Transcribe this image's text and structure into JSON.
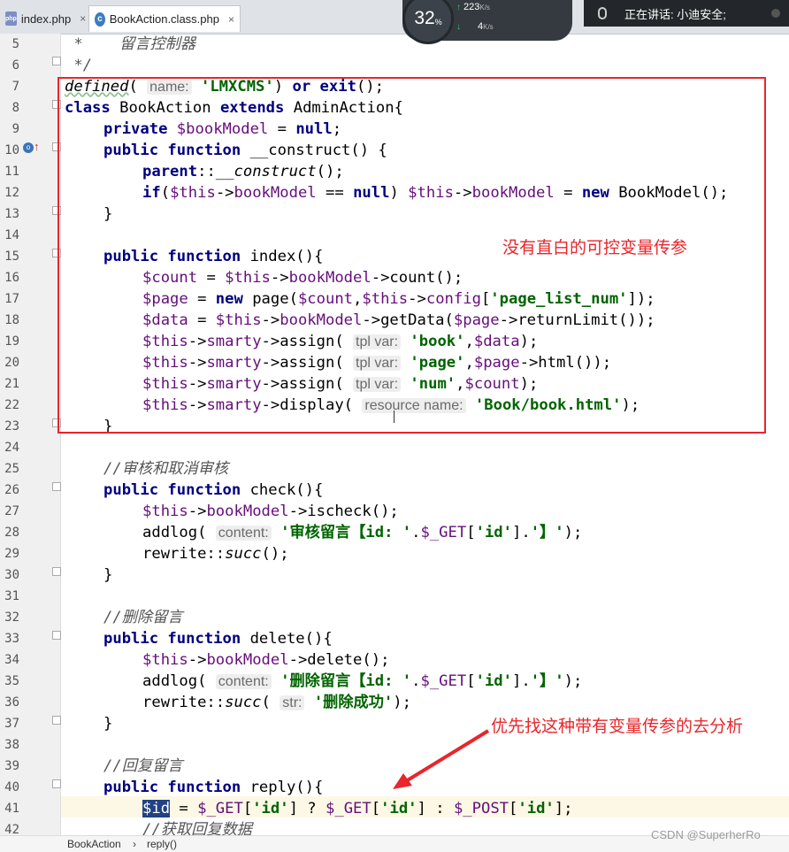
{
  "tabs": [
    {
      "label": "index.php",
      "icon": "php-file-icon",
      "close": "×"
    },
    {
      "label": "BookAction.class.php",
      "icon": "class-file-icon",
      "close": "×"
    }
  ],
  "monitor": {
    "cpu_value": "32",
    "cpu_unit": "%",
    "up_value": "223",
    "up_unit": "K/s",
    "down_value": "4",
    "down_unit": "K/s"
  },
  "voice": {
    "text": "正在讲话: 小迪安全;"
  },
  "line_numbers": [
    "5",
    "6",
    "7",
    "8",
    "9",
    "10",
    "11",
    "12",
    "13",
    "14",
    "15",
    "16",
    "17",
    "18",
    "19",
    "20",
    "21",
    "22",
    "23",
    "24",
    "25",
    "26",
    "27",
    "28",
    "29",
    "30",
    "31",
    "32",
    "33",
    "34",
    "35",
    "36",
    "37",
    "38",
    "39",
    "40",
    "41",
    "42"
  ],
  "code": {
    "l5": " *    留言控制器",
    "l6": " */",
    "l7_a": "defined",
    "l7_b": "( ",
    "l7_hint": "name:",
    "l7_c": " ",
    "l7_str": "'LMXCMS'",
    "l7_d": ") ",
    "l7_kw": "or",
    "l7_e": " ",
    "l7_kw2": "exit",
    "l7_f": "();",
    "l8_kw": "class",
    "l8_a": " BookAction ",
    "l8_kw2": "extends",
    "l8_b": " AdminAction{",
    "l9_kw": "private",
    "l9_var": "$bookModel",
    "l9_a": " = ",
    "l9_kw2": "null",
    "l9_b": ";",
    "l10_kw": "public function",
    "l10_a": " __construct() {",
    "l11_kw": "parent",
    "l11_a": "::",
    "l11_b": "__construct",
    "l11_c": "();",
    "l12_kw": "if",
    "l12_a": "(",
    "l12_var": "$this",
    "l12_b": "->",
    "l12_var2": "bookModel",
    "l12_c": " == ",
    "l12_kw2": "null",
    "l12_d": ") ",
    "l12_var3": "$this",
    "l12_e": "->",
    "l12_var4": "bookModel",
    "l12_f": " = ",
    "l12_kw3": "new",
    "l12_g": " BookModel();",
    "l13": "}",
    "l15_kw": "public function",
    "l15_a": " index(){",
    "l16_var": "$count",
    "l16_a": " = ",
    "l16_var2": "$this",
    "l16_b": "->",
    "l16_var3": "bookModel",
    "l16_c": "->count();",
    "l17_var": "$page",
    "l17_a": " = ",
    "l17_kw": "new",
    "l17_b": " page(",
    "l17_var2": "$count",
    "l17_c": ",",
    "l17_var3": "$this",
    "l17_d": "->",
    "l17_var4": "config",
    "l17_e": "[",
    "l17_str": "'page_list_num'",
    "l17_f": "]);",
    "l18_var": "$data",
    "l18_a": " = ",
    "l18_var2": "$this",
    "l18_b": "->",
    "l18_var3": "bookModel",
    "l18_c": "->getData(",
    "l18_var4": "$page",
    "l18_d": "->returnLimit());",
    "l19_var": "$this",
    "l19_a": "->",
    "l19_var2": "smarty",
    "l19_b": "->assign( ",
    "l19_hint": "tpl var:",
    "l19_c": " ",
    "l19_str": "'book'",
    "l19_d": ",",
    "l19_var3": "$data",
    "l19_e": ");",
    "l20_var": "$this",
    "l20_a": "->",
    "l20_var2": "smarty",
    "l20_b": "->assign( ",
    "l20_hint": "tpl var:",
    "l20_c": " ",
    "l20_str": "'page'",
    "l20_d": ",",
    "l20_var3": "$page",
    "l20_e": "->html());",
    "l21_var": "$this",
    "l21_a": "->",
    "l21_var2": "smarty",
    "l21_b": "->assign( ",
    "l21_hint": "tpl var:",
    "l21_c": " ",
    "l21_str": "'num'",
    "l21_d": ",",
    "l21_var3": "$count",
    "l21_e": ");",
    "l22_var": "$this",
    "l22_a": "->",
    "l22_var2": "smarty",
    "l22_b": "->display( ",
    "l22_hint": "resource name:",
    "l22_c": " ",
    "l22_str": "'Book/book.html'",
    "l22_d": ");",
    "l23": "}",
    "l25": "//审核和取消审核",
    "l26_kw": "public function",
    "l26_a": " check(){",
    "l27_var": "$this",
    "l27_a": "->",
    "l27_var2": "bookModel",
    "l27_b": "->ischeck();",
    "l28_a": "addlog( ",
    "l28_hint": "content:",
    "l28_b": " ",
    "l28_str": "'审核留言【id: '",
    "l28_c": ".",
    "l28_var": "$_GET",
    "l28_d": "[",
    "l28_str2": "'id'",
    "l28_e": "].",
    "l28_str3": "'】'",
    "l28_f": ");",
    "l29_a": "rewrite::",
    "l29_b": "succ",
    "l29_c": "();",
    "l30": "}",
    "l32": "//删除留言",
    "l33_kw": "public function",
    "l33_a": " delete(){",
    "l34_var": "$this",
    "l34_a": "->",
    "l34_var2": "bookModel",
    "l34_b": "->delete();",
    "l35_a": "addlog( ",
    "l35_hint": "content:",
    "l35_b": " ",
    "l35_str": "'删除留言【id: '",
    "l35_c": ".",
    "l35_var": "$_GET",
    "l35_d": "[",
    "l35_str2": "'id'",
    "l35_e": "].",
    "l35_str3": "'】'",
    "l35_f": ");",
    "l36_a": "rewrite::",
    "l36_b": "succ",
    "l36_c": "( ",
    "l36_hint": "str:",
    "l36_d": " ",
    "l36_str": "'删除成功'",
    "l36_e": ");",
    "l37": "}",
    "l39": "//回复留言",
    "l40_kw": "public function",
    "l40_a": " reply(){",
    "l41_sel": "$id",
    "l41_a": " = ",
    "l41_var": "$_GET",
    "l41_b": "[",
    "l41_str": "'id'",
    "l41_c": "] ? ",
    "l41_var2": "$_GET",
    "l41_d": "[",
    "l41_str2": "'id'",
    "l41_e": "] : ",
    "l41_var3": "$_POST",
    "l41_f": "[",
    "l41_str3": "'id'",
    "l41_g": "];",
    "l42": "//获取回复数据"
  },
  "annotations": {
    "box_note": "没有直白的可控变量传参",
    "arrow_note": "优先找这种带有变量传参的去分析",
    "color": "#e8262b"
  },
  "breadcrumb": {
    "class": "BookAction",
    "sep": "›",
    "method": "reply()"
  },
  "watermark": "CSDN @SuperherRo"
}
